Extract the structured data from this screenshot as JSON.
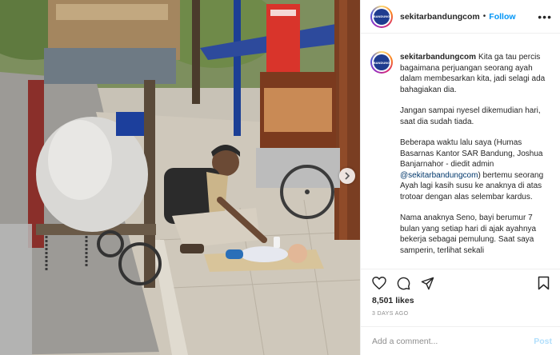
{
  "post": {
    "username": "sekitarbandungcom",
    "follow_label": "Follow",
    "more_label": "•••",
    "avatar_text": "BANDUNG",
    "caption": [
      "Kita ga tau percis bagaimana perjuangan seorang ayah dalam membesarkan kita, jadi selagi ada bahagiakan dia.",
      "Jangan sampai nyesel dikemudian hari, saat dia sudah tiada.",
      "Nama anaknya Seno, bayi berumur 7 bulan yang setiap hari di ajak ayahnya bekerja sebagai pemulung. Saat saya samperin, terlihat sekali"
    ],
    "caption_p3_before": "Beberapa waktu lalu saya (Humas Basarnas Kantor SAR Bandung, Joshua Banjarnahor - diedit admin ",
    "caption_p3_mention": "@sekitarbandungcom",
    "caption_p3_after": ") bertemu seorang Ayah lagi kasih susu ke anaknya di atas trotoar dengan alas selembar kardus.",
    "likes": "8,501 likes",
    "timestamp": "3 DAYS AGO",
    "comment_placeholder": "Add a comment...",
    "post_label": "Post"
  },
  "icons": {
    "like": "heart-icon",
    "comment": "comment-icon",
    "share": "share-icon",
    "save": "bookmark-icon",
    "next": "chevron-right-icon"
  },
  "colors": {
    "link": "#0095f6",
    "mention": "#00376b",
    "post_disabled": "#b2dffc",
    "muted": "#8e8e8e"
  }
}
